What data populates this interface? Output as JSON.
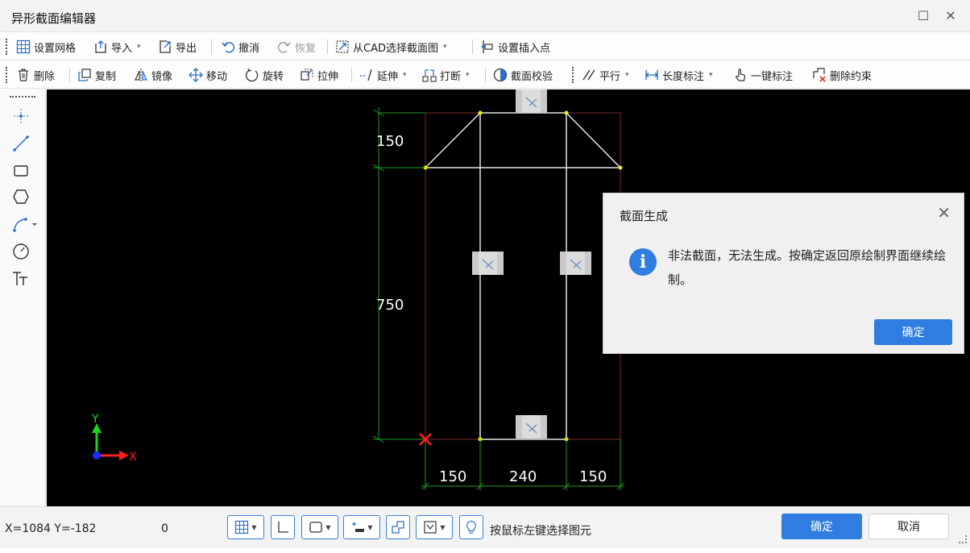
{
  "window": {
    "title": "异形截面编辑器"
  },
  "toolbar1": {
    "set_grid": "设置网格",
    "import": "导入",
    "export": "导出",
    "undo": "撤消",
    "redo": "恢复",
    "select_from_cad": "从CAD选择截面图",
    "set_insert_point": "设置插入点"
  },
  "toolbar2": {
    "delete": "删除",
    "copy": "复制",
    "mirror": "镜像",
    "move": "移动",
    "rotate": "旋转",
    "stretch": "拉伸",
    "extend": "延伸",
    "break": "打断",
    "section_check": "截面校验",
    "parallel": "平行",
    "length_dim": "长度标注",
    "one_click_dim": "一键标注",
    "delete_constraint": "删除约束"
  },
  "canvas": {
    "dims": {
      "top_height": "150",
      "mid_height": "750",
      "bottom_left": "150",
      "bottom_center": "240",
      "bottom_right": "150"
    },
    "axes": {
      "x_label": "X",
      "y_label": "Y"
    }
  },
  "dialog": {
    "title": "截面生成",
    "message": "非法截面，无法生成。按确定返回原绘制界面继续绘制。",
    "ok": "确定",
    "icon": "info-icon"
  },
  "statusbar": {
    "coords": "X=1084 Y=-182",
    "value": "0",
    "hint": "按鼠标左键选择图元",
    "ok": "确定",
    "cancel": "取消"
  },
  "colors": {
    "accent": "#2f7de1",
    "canvas_bg": "#000000",
    "dim_line": "#1f9a1f",
    "outline": "#ffffff",
    "bound_box": "#7a2a2a",
    "vertex": "#f0f000",
    "origin_mark": "#ff2020"
  }
}
